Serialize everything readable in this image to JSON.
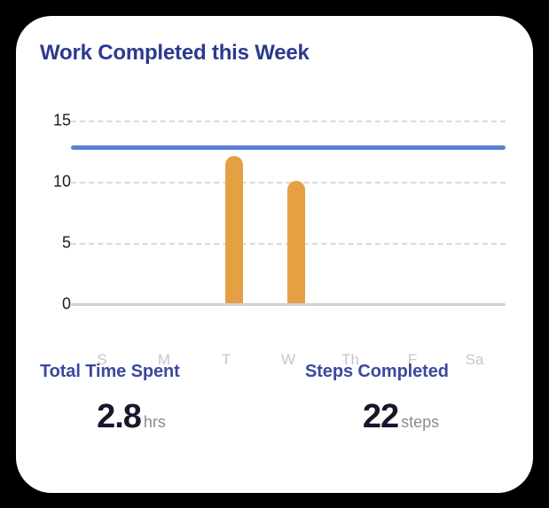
{
  "card": {
    "title": "Work Completed this Week",
    "background_color": "#ffffff",
    "page_background_color": "#000000",
    "title_color": "#2b3a8f"
  },
  "chart_data": {
    "type": "bar",
    "title": "Work Completed this Week",
    "xlabel": "",
    "ylabel": "",
    "categories": [
      "S",
      "M",
      "T",
      "W",
      "Th",
      "F",
      "Sa"
    ],
    "values": [
      0,
      0,
      12,
      10,
      0,
      0,
      0
    ],
    "series": [
      {
        "name": "Work Completed",
        "values": [
          0,
          0,
          12,
          10,
          0,
          0,
          0
        ],
        "color": "#e5a044"
      }
    ],
    "ylim": [
      0,
      15
    ],
    "yticks": [
      0,
      5,
      10,
      15
    ],
    "ytick_labels": [
      "0",
      "5",
      "10",
      "15"
    ],
    "grid": true,
    "grid_style": "dashed",
    "grid_color": "#d9d9de",
    "legend": false,
    "annotations": [
      {
        "name": "target-line",
        "type": "hline",
        "value": 13,
        "color": "#5d80d6"
      }
    ],
    "bar_color": "#e5a044",
    "baseline_color": "#cfcfd4",
    "tick_label_color": "#c7c7cc"
  },
  "stats": [
    {
      "label": "Total Time Spent",
      "value": "2.8",
      "unit": "hrs"
    },
    {
      "label": "Steps Completed",
      "value": "22",
      "unit": "steps"
    }
  ]
}
